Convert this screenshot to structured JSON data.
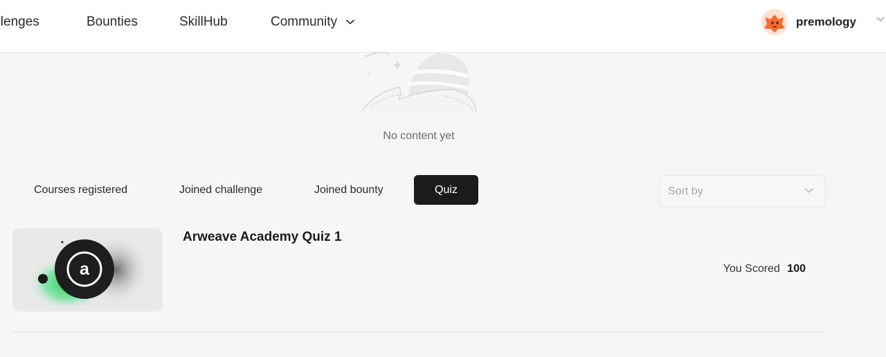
{
  "nav": {
    "items": [
      {
        "label": "allenges"
      },
      {
        "label": "Bounties"
      },
      {
        "label": "SkillHub"
      },
      {
        "label": "Community"
      }
    ],
    "user": {
      "name": "premology"
    }
  },
  "empty_state": {
    "text": "No content yet"
  },
  "tabs": [
    {
      "label": "Courses registered",
      "active": false
    },
    {
      "label": "Joined challenge",
      "active": false
    },
    {
      "label": "Joined bounty",
      "active": false
    },
    {
      "label": "Quiz",
      "active": true
    }
  ],
  "sort": {
    "placeholder": "Sort by"
  },
  "quizzes": [
    {
      "title": "Arweave Academy Quiz 1",
      "score_label": "You Scored",
      "score": "100",
      "icon": "arweave-logo-icon"
    }
  ],
  "colors": {
    "accent_dark": "#1b1b1b",
    "background": "#f6f6f6",
    "avatar": "#f26a2e"
  }
}
